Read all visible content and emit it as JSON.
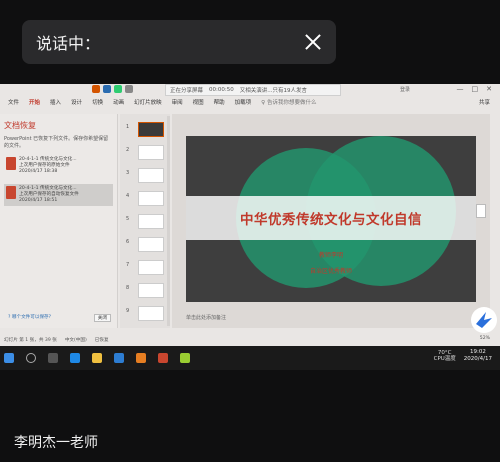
{
  "overlay": {
    "speaking_label": "说话中："
  },
  "meeting": {
    "text": "正在分享屏幕",
    "timer": "00:00:50",
    "status": "又相关演讲...只有19人发言"
  },
  "ribbon": {
    "tabs": [
      "文件",
      "开始",
      "插入",
      "设计",
      "切换",
      "动画",
      "幻灯片放映",
      "审阅",
      "视图",
      "帮助",
      "加载项"
    ],
    "active_tab": "开始",
    "tell_me": "♀ 告诉我你想要做什么",
    "login": "登录",
    "share": "共享"
  },
  "recovery": {
    "title": "文档恢复",
    "intro": "PowerPoint 已恢复下列文件。保存你希望保留的文件。",
    "files": [
      {
        "name": "20-4-1-1 传统文化与文化...",
        "desc": "上次用户保存的原始文件",
        "date": "2020/4/17 18:38"
      },
      {
        "name": "20-4-1-1 传统文化与文化...",
        "desc": "上次用户保存的自动恢复文件",
        "date": "2020/4/17 18:51"
      }
    ],
    "link": "?  哪个文件可以保存?",
    "close": "关闭"
  },
  "thumbnails": {
    "numbers": [
      "1",
      "2",
      "3",
      "4",
      "5",
      "6",
      "7",
      "8",
      "9"
    ]
  },
  "slide": {
    "title": "中华优秀传统文化与文化自信",
    "subtitle_1": "教师李明",
    "subtitle_2": "自治区优秀教师"
  },
  "notes": {
    "placeholder": "单击此处添加备注"
  },
  "statusbar": {
    "left": "幻灯片 第 1 张，共 39 张",
    "lang": "中文(中国)",
    "recovered": "已恢复",
    "zoom": "52%"
  },
  "taskbar": {
    "weather": "70°C",
    "cpu": "CPU温度",
    "time": "19:02",
    "date": "2020/4/17"
  },
  "presenter": {
    "name": "李明杰一老师"
  },
  "colors": {
    "accent": "#c0392b",
    "ppt_red": "#c8462f",
    "slide_bg": "#3e3e3e",
    "circle_green": "#22966e"
  }
}
